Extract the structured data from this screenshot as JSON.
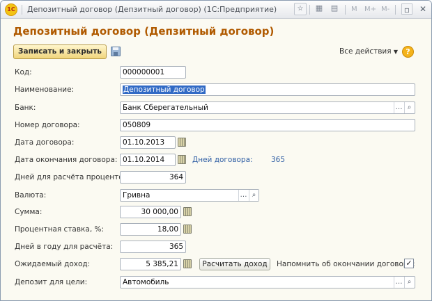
{
  "window": {
    "title": "Депозитный договор (Депзитный договор)",
    "app": "(1С:Предприятие)",
    "logo": "1С",
    "icons": [
      "star-icon",
      "grid-icon",
      "calendar-icon"
    ],
    "m_labels": [
      "M",
      "M+",
      "M-"
    ]
  },
  "page": {
    "heading": "Депозитный договор (Депзитный договор)",
    "save_close_label": "Записать и закрыть",
    "all_actions_label": "Все действия",
    "help_label": "?"
  },
  "form": {
    "code": {
      "label": "Код:",
      "value": "000000001"
    },
    "name": {
      "label": "Наименование:",
      "value": "Депозитный договор"
    },
    "bank": {
      "label": "Банк:",
      "value": "Банк Сберегательный"
    },
    "contract_no": {
      "label": "Номер договора:",
      "value": "050809"
    },
    "contract_date": {
      "label": "Дата договора:",
      "value": "01.10.2013"
    },
    "end_date": {
      "label": "Дата окончания договора:",
      "value": "01.10.2014"
    },
    "contract_days": {
      "label": "Дней договора:",
      "value": "365"
    },
    "interest_days": {
      "label": "Дней для расчёта процентов:",
      "value": "364"
    },
    "currency": {
      "label": "Валюта:",
      "value": "Гривна"
    },
    "amount": {
      "label": "Сумма:",
      "value": "30 000,00"
    },
    "rate": {
      "label": "Процентная ставка, %:",
      "value": "18,00"
    },
    "days_per_year": {
      "label": "Дней в году для расчёта:",
      "value": "365"
    },
    "expected_income": {
      "label": "Ожидаемый доход:",
      "value": "5 385,21"
    },
    "calc_button_label": "Расчитать доход",
    "remind": {
      "label": "Напомнить об окончании договора:",
      "checked": true,
      "mark": "✓"
    },
    "purpose": {
      "label": "Депозит для цели:",
      "value": "Автомобиль"
    }
  },
  "colors": {
    "heading": "#b05a00",
    "link": "#2f5ea4",
    "selection": "#316ac5"
  }
}
